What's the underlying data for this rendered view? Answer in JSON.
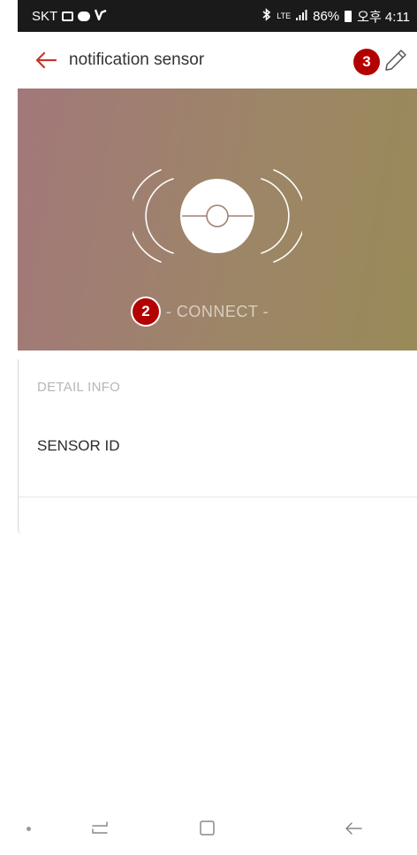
{
  "status_bar": {
    "carrier": "SKT",
    "network": "LTE",
    "battery": "86%",
    "time": "오후 4:11"
  },
  "app_bar": {
    "title": "notification sensor"
  },
  "hero": {
    "status": "- CONNECT -"
  },
  "detail": {
    "heading": "DETAIL INFO",
    "sensor_id_label": "SENSOR ID"
  },
  "badges": {
    "edit_marker": "3",
    "connect_marker": "2"
  },
  "colors": {
    "accent": "#c0392b",
    "badge": "#b30000",
    "hero_start": "#a2787a",
    "hero_end": "#998a58"
  }
}
